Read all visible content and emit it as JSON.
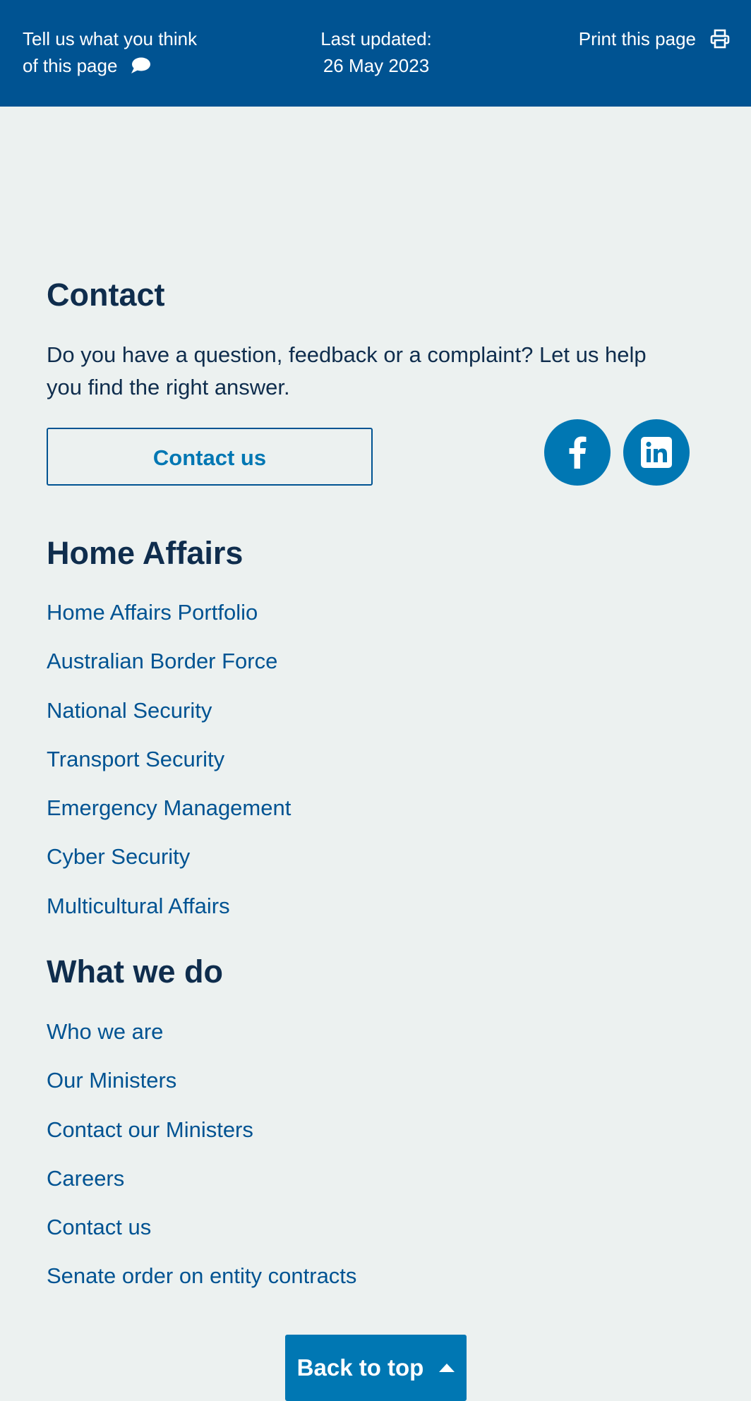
{
  "topbar": {
    "feedback_line1": "Tell us what you think",
    "feedback_line2": "of this page",
    "feedback_icon": "speech-bubble-icon",
    "updated_label": "Last updated:",
    "updated_date": "26 May 2023",
    "print_label": "Print this page",
    "print_icon": "printer-icon",
    "bg_color": "#005392"
  },
  "contact": {
    "heading": "Contact",
    "text": "Do you have a question, feedback or a complaint? Let us help you find the right answer.",
    "button_label": "Contact us",
    "social": [
      "facebook-icon",
      "linkedin-icon"
    ]
  },
  "home_affairs": {
    "heading": "Home Affairs",
    "links": [
      "Home Affairs Portfolio",
      "Australian Border Force",
      "National Security",
      "Transport Security",
      "Emergency Management",
      "Cyber Security",
      "Multicultural Affairs"
    ]
  },
  "what_we_do": {
    "heading": "What we do",
    "links": [
      "Who we are",
      "Our Ministers",
      "Contact our Ministers",
      "Careers",
      "Contact us",
      "Senate order on entity contracts"
    ]
  },
  "back_to_top": {
    "label": "Back to top",
    "icon": "caret-up-icon"
  },
  "colors": {
    "page_bg": "#ecf1f0",
    "heading": "#0f2d4d",
    "link": "#005392",
    "accent": "#0077b3"
  }
}
